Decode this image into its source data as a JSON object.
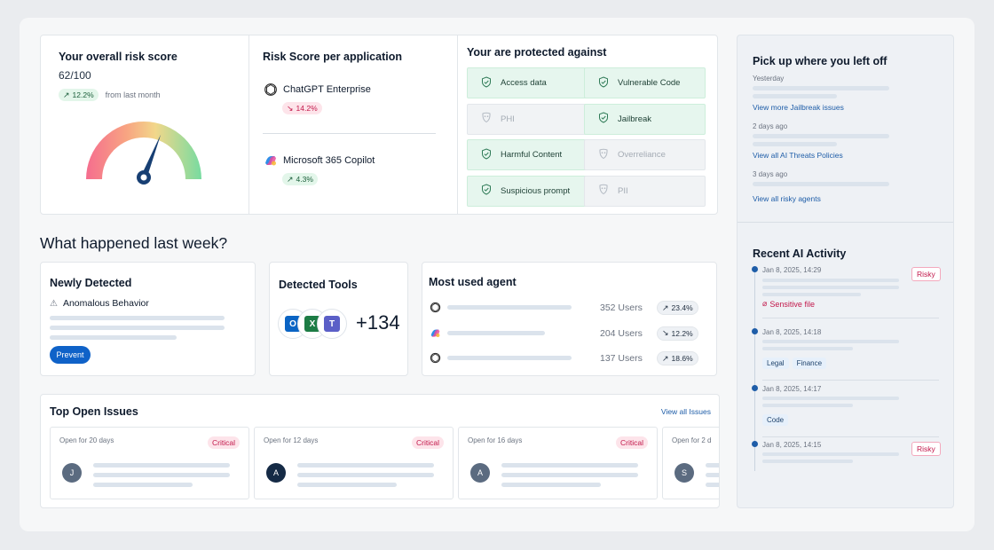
{
  "risk": {
    "title": "Your overall risk score",
    "score": "62/100",
    "change": "12.2%",
    "change_suffix": "from last month",
    "gauge_value": 0.62
  },
  "apps": {
    "title": "Risk Score per application",
    "items": [
      {
        "name": "ChatGPT Enterprise",
        "change": "14.2%",
        "trend": "down"
      },
      {
        "name": "Microsoft 365 Copilot",
        "change": "4.3%",
        "trend": "up"
      }
    ]
  },
  "protection": {
    "title": "Your are protected against",
    "items": [
      {
        "label": "Access data",
        "active": true
      },
      {
        "label": "Vulnerable Code",
        "active": true
      },
      {
        "label": "PHI",
        "active": false
      },
      {
        "label": "Jailbreak",
        "active": true
      },
      {
        "label": "Harmful Content",
        "active": true
      },
      {
        "label": "Overreliance",
        "active": false
      },
      {
        "label": "Suspicious prompt",
        "active": true
      },
      {
        "label": "PII",
        "active": false
      }
    ]
  },
  "section_title": "What happened last week?",
  "newly_detected": {
    "title": "Newly Detected",
    "item": "Anomalous Behavior",
    "button": "Prevent"
  },
  "detected_tools": {
    "title": "Detected Tools",
    "count": "+134",
    "icons": [
      "outlook-icon",
      "excel-icon",
      "teams-icon"
    ]
  },
  "agents": {
    "title": "Most used agent",
    "rows": [
      {
        "icon": "openai-icon",
        "users": "352 Users",
        "change": "23.4%",
        "trend": "up"
      },
      {
        "icon": "copilot-icon",
        "users": "204 Users",
        "change": "12.2%",
        "trend": "down"
      },
      {
        "icon": "openai-icon",
        "users": "137 Users",
        "change": "18.6%",
        "trend": "up"
      }
    ]
  },
  "issues": {
    "title": "Top Open Issues",
    "view_all": "View all Issues",
    "items": [
      {
        "open": "Open for 20 days",
        "badge": "Critical",
        "initial": "J"
      },
      {
        "open": "Open for 12 days",
        "badge": "Critical",
        "initial": "A"
      },
      {
        "open": "Open for 16 days",
        "badge": "Critical",
        "initial": "A"
      },
      {
        "open": "Open for 2 d",
        "badge": "",
        "initial": "S"
      }
    ]
  },
  "pickup": {
    "title": "Pick up where you left off",
    "groups": [
      {
        "when": "Yesterday",
        "link": "View more Jailbreak issues"
      },
      {
        "when": "2 days ago",
        "link": "View all AI Threats Policies"
      },
      {
        "when": "3 days ago",
        "link": "View all risky agents"
      }
    ]
  },
  "activity": {
    "title": "Recent AI Activity",
    "items": [
      {
        "time": "Jan 8, 2025, 14:29",
        "badge": "Risky",
        "file": "Sensitive file",
        "tags": []
      },
      {
        "time": "Jan 8, 2025, 14:18",
        "badge": "",
        "file": "",
        "tags": [
          "Legal",
          "Finance"
        ]
      },
      {
        "time": "Jan 8, 2025, 14:17",
        "badge": "",
        "file": "",
        "tags": [
          "Code"
        ]
      },
      {
        "time": "Jan 8, 2025, 14:15",
        "badge": "Risky",
        "file": "",
        "tags": []
      }
    ]
  },
  "colors": {
    "accent": "#0f62c8",
    "good": "#1b8a4c",
    "bad": "#c2184b",
    "gauge_needle": "#173f73"
  }
}
